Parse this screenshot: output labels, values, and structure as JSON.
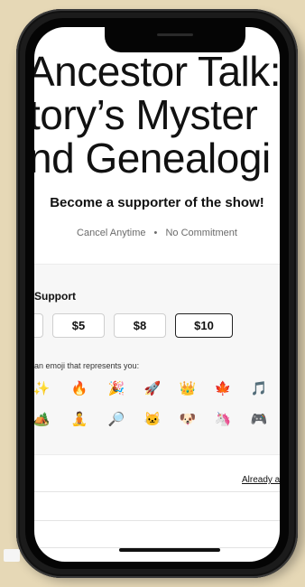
{
  "page": {
    "title_lines": [
      "Ancestor Talk:",
      "tory’s Myster",
      "nd Genealogi -"
    ],
    "subtitle": "Become a supporter of the show!",
    "terms": {
      "left": "Cancel Anytime",
      "separator": "•",
      "right": "No Commitment"
    }
  },
  "support": {
    "label": "Support",
    "amounts": [
      "$5",
      "$8",
      "$10"
    ],
    "selected_amount": "$10",
    "emoji_hint": "an emoji that represents you:",
    "emojis_row1": [
      "✨",
      "🔥",
      "🎉",
      "🚀",
      "👑",
      "🍁",
      "🎵"
    ],
    "emojis_row2": [
      "🏕️",
      "🧘",
      "🔎",
      "🐱",
      "🐶",
      "🦄",
      "🎮"
    ]
  },
  "footer": {
    "already_link": "Already a"
  }
}
